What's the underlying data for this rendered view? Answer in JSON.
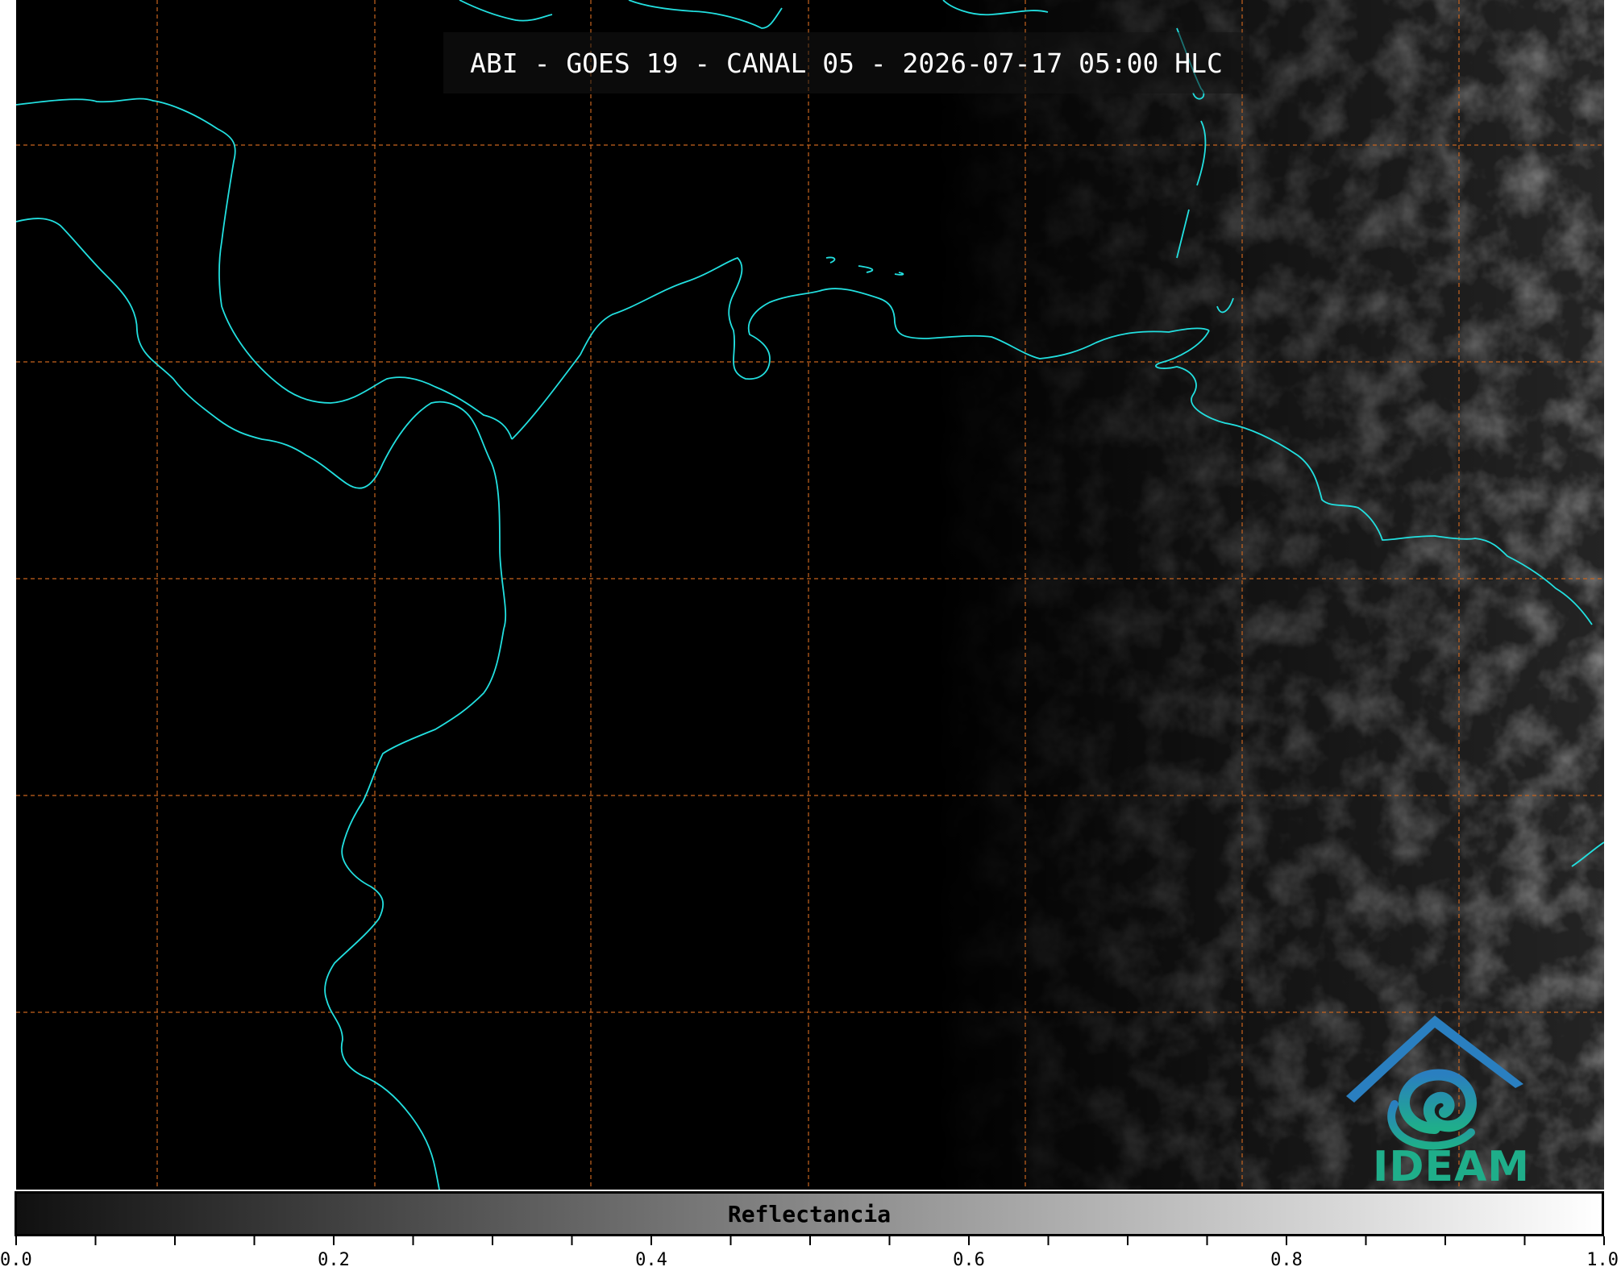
{
  "title": "ABI - GOES 19 - CANAL 05 - 2026-07-17 05:00 HLC",
  "logo": {
    "name": "IDEAM"
  },
  "colorbar": {
    "label": "Reflectancia",
    "range": [
      0.0,
      1.0
    ],
    "gradient": [
      "#101010",
      "#ffffff"
    ],
    "major_ticks": [
      "0.0",
      "0.2",
      "0.4",
      "0.6",
      "0.8",
      "1.0"
    ],
    "minor_tick_step": 0.05
  },
  "colors": {
    "background": "#000000",
    "coastline": "#22e0e0",
    "gridlines": "#c8641e",
    "logo_blue": "#2a7fc0",
    "logo_green": "#1fae8a"
  },
  "gridlines": {
    "style": "dashed"
  }
}
